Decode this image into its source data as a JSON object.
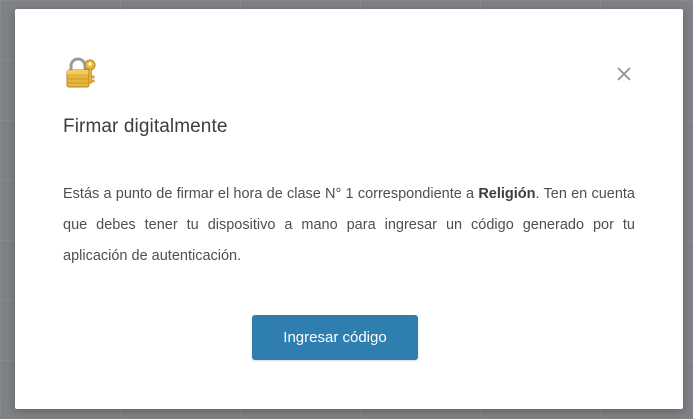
{
  "dialog": {
    "icon": "lock-with-key-icon",
    "close_icon": "close-icon",
    "title": "Firmar digitalmente",
    "message": {
      "before_subject": "Estás a punto de firmar el hora de clase N° 1 correspondiente a ",
      "subject": "Religión",
      "after_subject": ". Ten en cuenta que debes tener tu dispositivo a mano para ingresar un código generado por tu aplicación de autenticación."
    },
    "primary_button_label": "Ingresar código",
    "colors": {
      "primary_button": "#2f7eb0",
      "overlay": "#7f8286",
      "title_text": "#3a3d41",
      "body_text": "#4c4f54"
    }
  }
}
